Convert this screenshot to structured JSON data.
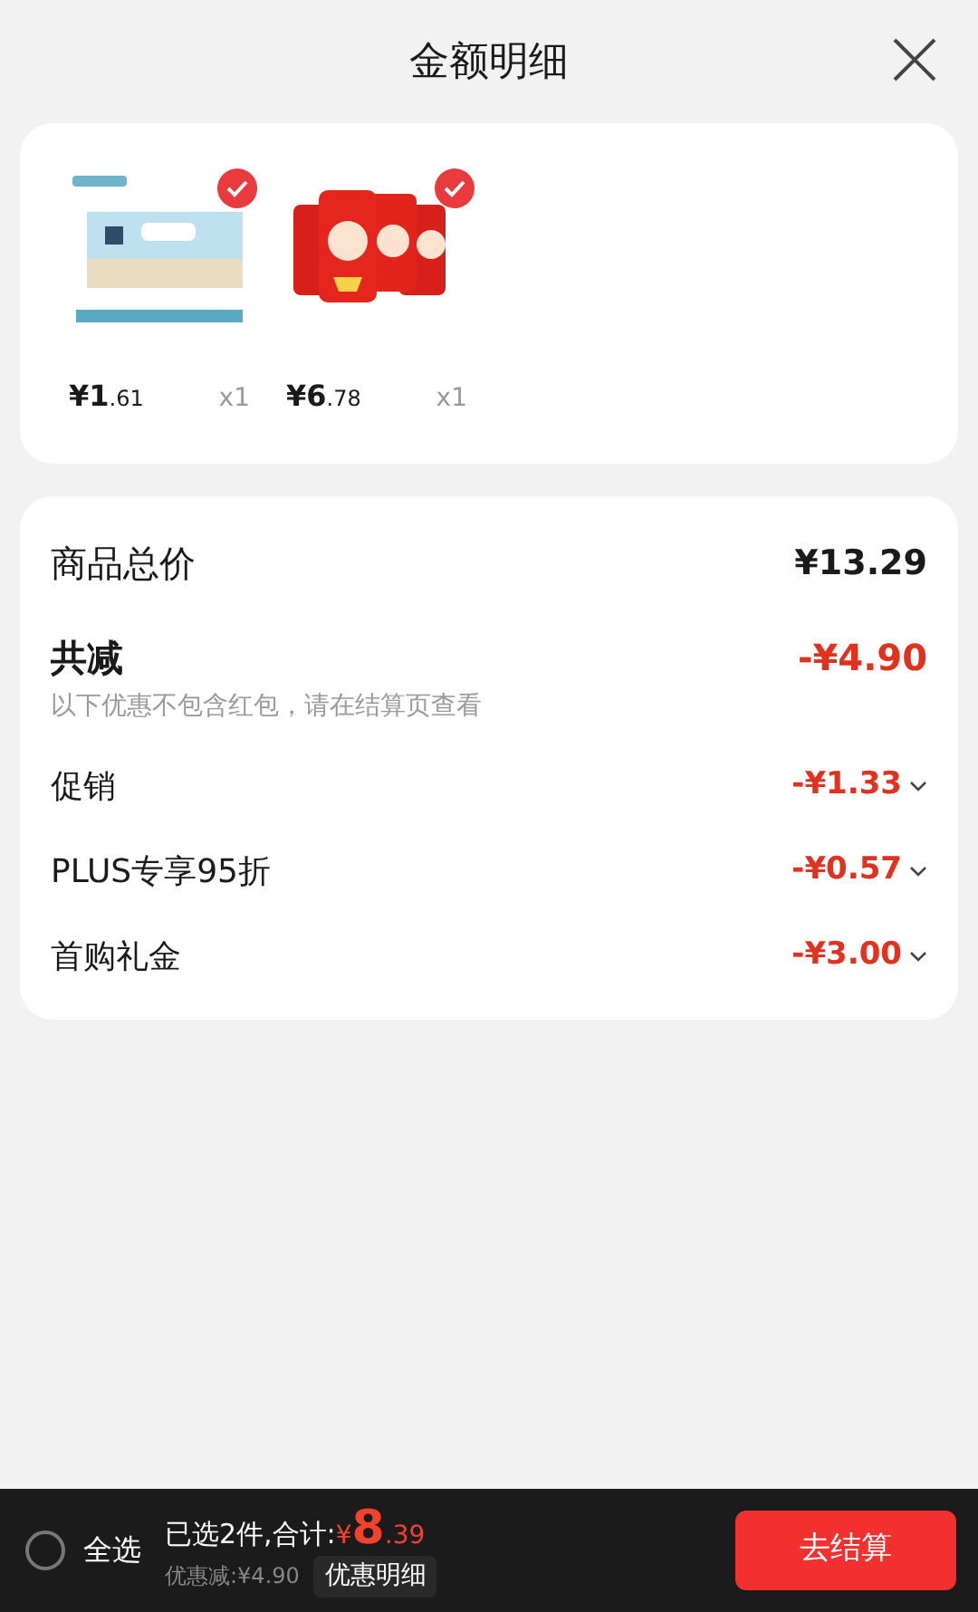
{
  "header": {
    "title": "金额明细"
  },
  "products": [
    {
      "kind": "picture",
      "checked": true,
      "price_main": "¥1",
      "price_cents": ".61",
      "quantity": "x1"
    },
    {
      "kind": "picture",
      "checked": true,
      "price_main": "¥6",
      "price_cents": ".78",
      "quantity": "x1"
    }
  ],
  "summary": {
    "total_label": "商品总价",
    "total_value": "¥13.29",
    "discount_label": "共减",
    "discount_value": "-¥4.90",
    "note": "以下优惠不包含红包，请在结算页查看",
    "items": [
      {
        "label": "促销",
        "value": "-¥1.33",
        "expanded": false
      },
      {
        "label": "PLUS专享95折",
        "value": "-¥0.57",
        "expanded": false
      },
      {
        "label": "首购礼金",
        "value": "-¥3.00",
        "expanded": false
      }
    ]
  },
  "footer": {
    "select_all": {
      "label": "全选",
      "checked": false
    },
    "selected_text": "已选2件,合计:",
    "currency": "¥",
    "total_main": "8",
    "total_cents": ".39",
    "saved": "优惠减:¥4.90",
    "details_button": "优惠明细",
    "checkout_button": "去结算"
  }
}
